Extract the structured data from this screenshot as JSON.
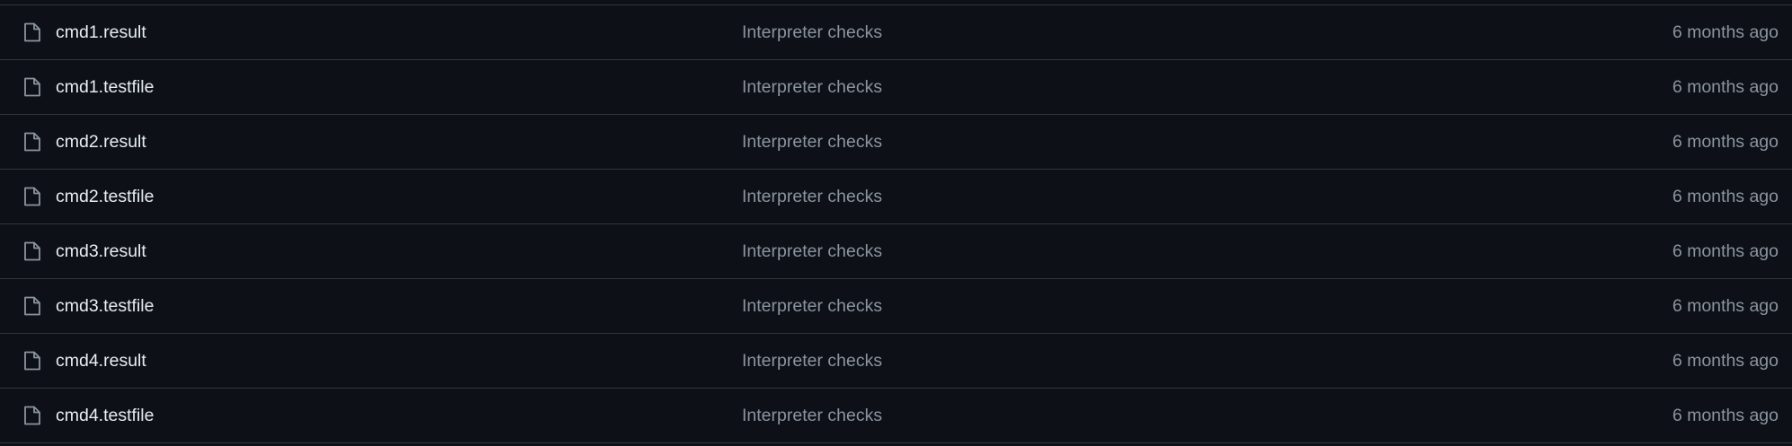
{
  "colors": {
    "background": "#0d1117",
    "border": "#30363d",
    "file_name": "#e6edf3",
    "muted_text": "#8b949e",
    "icon": "#8b949e"
  },
  "file_list": {
    "rows": [
      {
        "icon": "file-icon",
        "name": "cmd1.result",
        "commit_message": "Interpreter checks",
        "age": "6 months ago"
      },
      {
        "icon": "file-icon",
        "name": "cmd1.testfile",
        "commit_message": "Interpreter checks",
        "age": "6 months ago"
      },
      {
        "icon": "file-icon",
        "name": "cmd2.result",
        "commit_message": "Interpreter checks",
        "age": "6 months ago"
      },
      {
        "icon": "file-icon",
        "name": "cmd2.testfile",
        "commit_message": "Interpreter checks",
        "age": "6 months ago"
      },
      {
        "icon": "file-icon",
        "name": "cmd3.result",
        "commit_message": "Interpreter checks",
        "age": "6 months ago"
      },
      {
        "icon": "file-icon",
        "name": "cmd3.testfile",
        "commit_message": "Interpreter checks",
        "age": "6 months ago"
      },
      {
        "icon": "file-icon",
        "name": "cmd4.result",
        "commit_message": "Interpreter checks",
        "age": "6 months ago"
      },
      {
        "icon": "file-icon",
        "name": "cmd4.testfile",
        "commit_message": "Interpreter checks",
        "age": "6 months ago"
      }
    ]
  }
}
